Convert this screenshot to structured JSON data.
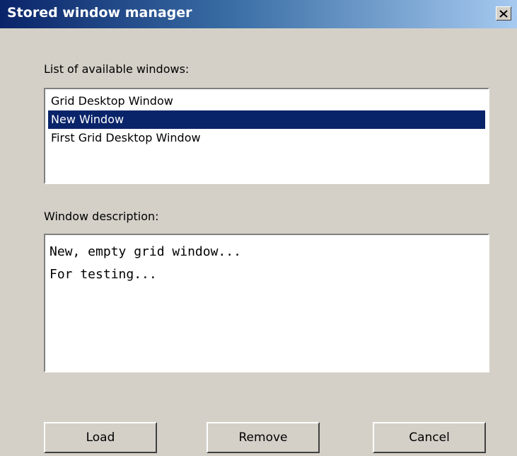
{
  "window": {
    "title": "Stored window manager",
    "close_icon": "close-icon"
  },
  "list_label": "List of available windows:",
  "windows_list": [
    {
      "label": "Grid Desktop Window",
      "selected": false
    },
    {
      "label": "New Window",
      "selected": true
    },
    {
      "label": "First Grid Desktop Window",
      "selected": false
    }
  ],
  "description_label": "Window description:",
  "description_lines": [
    "New, empty grid window...",
    "For testing..."
  ],
  "buttons": {
    "load": "Load",
    "remove": "Remove",
    "cancel": "Cancel"
  },
  "colors": {
    "titlebar_start": "#0a246a",
    "titlebar_end": "#a6caf0",
    "selection": "#0a246a",
    "dialog_face": "#d4d0c8"
  }
}
